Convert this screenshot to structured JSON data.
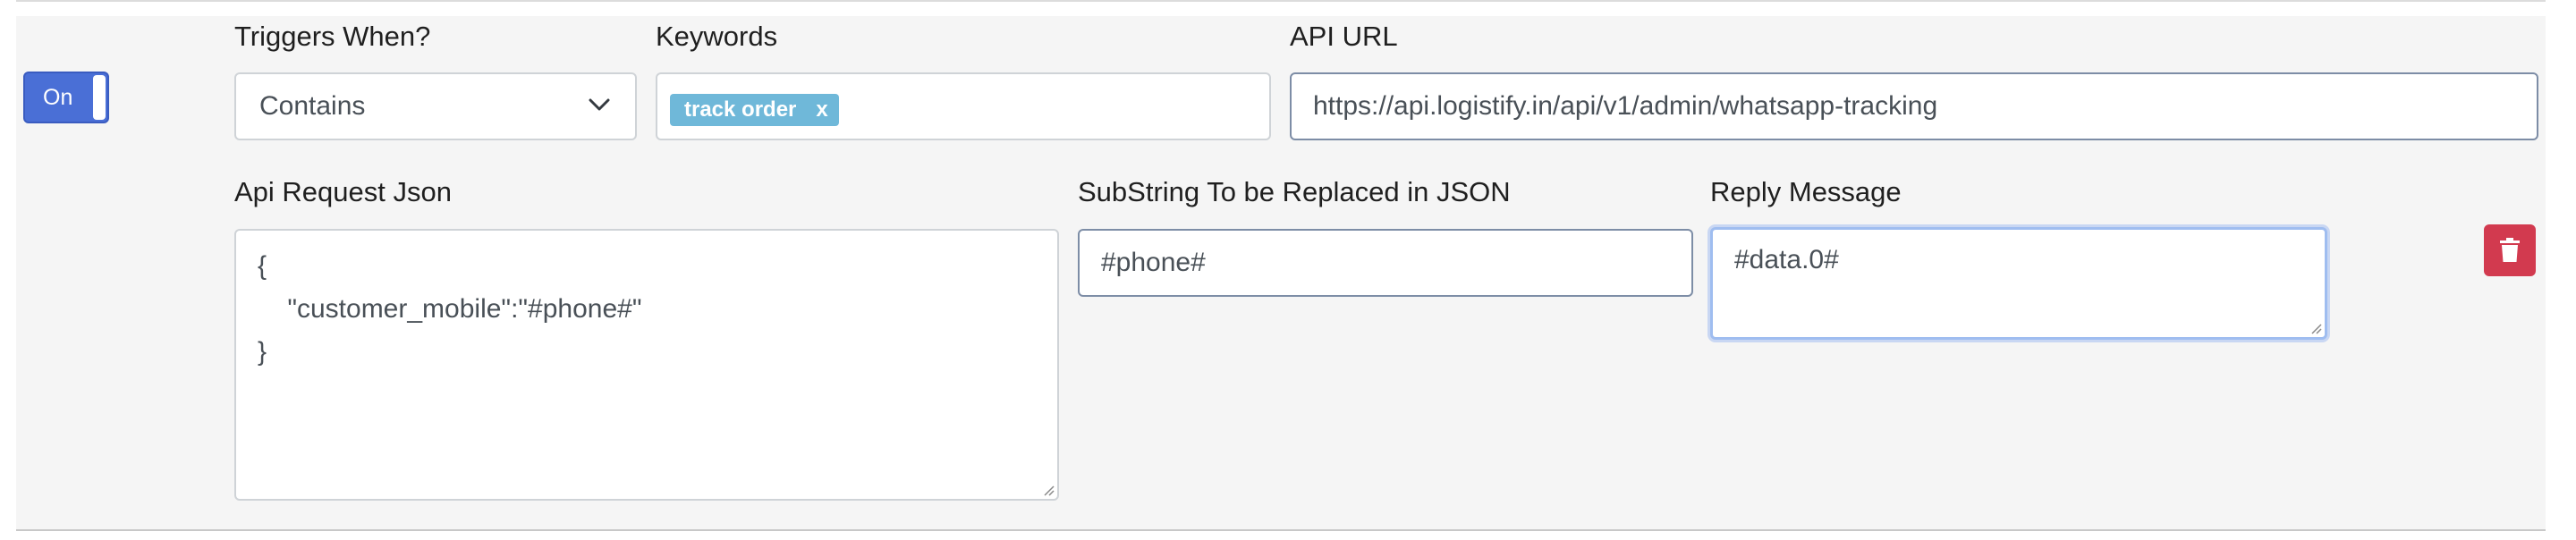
{
  "toggle": {
    "label": "On",
    "state": "on",
    "color": "#4a6fd6"
  },
  "triggers": {
    "label": "Triggers When?",
    "selected": "Contains"
  },
  "keywords": {
    "label": "Keywords",
    "tags": [
      "track order"
    ],
    "remove_glyph": "x",
    "tag_color": "#6fb8d9"
  },
  "api_url": {
    "label": "API URL",
    "value": "https://api.logistify.in/api/v1/admin/whatsapp-tracking"
  },
  "api_request_json": {
    "label": "Api Request Json",
    "value": "{\n    \"customer_mobile\":\"#phone#\"\n}"
  },
  "substring": {
    "label": "SubString To be Replaced in JSON",
    "value": "#phone#"
  },
  "reply_message": {
    "label": "Reply Message",
    "value": "#data.0#"
  },
  "delete": {
    "icon": "trash-icon",
    "color": "#d23a4f"
  }
}
